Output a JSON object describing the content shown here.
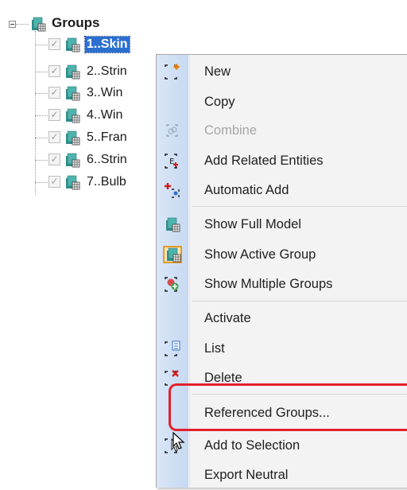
{
  "tree": {
    "root": {
      "label": "Groups",
      "icon": "group-folder-icon"
    },
    "items": [
      {
        "label": "1..Skin",
        "checked": true,
        "selected": true
      },
      {
        "label": "2..Strin",
        "checked": true,
        "selected": false
      },
      {
        "label": "3..Win",
        "checked": true,
        "selected": false
      },
      {
        "label": "4..Win",
        "checked": true,
        "selected": false
      },
      {
        "label": "5..Fran",
        "checked": true,
        "selected": false
      },
      {
        "label": "6..Strin",
        "checked": true,
        "selected": false
      },
      {
        "label": "7..Bulb",
        "checked": true,
        "selected": false
      }
    ]
  },
  "context_menu": {
    "items": [
      {
        "label": "New",
        "icon": "new-icon",
        "enabled": true
      },
      {
        "label": "Copy",
        "icon": "",
        "enabled": true
      },
      {
        "label": "Combine",
        "icon": "combine-icon",
        "enabled": false
      },
      {
        "label": "Add Related Entities",
        "icon": "add-related-icon",
        "enabled": true
      },
      {
        "label": "Automatic Add",
        "icon": "automatic-add-icon",
        "enabled": true
      },
      {
        "label": "Show Full Model",
        "icon": "full-model-icon",
        "enabled": true
      },
      {
        "label": "Show Active Group",
        "icon": "active-group-icon",
        "enabled": true
      },
      {
        "label": "Show Multiple Groups",
        "icon": "multiple-groups-icon",
        "enabled": true
      },
      {
        "label": "Activate",
        "icon": "",
        "enabled": true
      },
      {
        "label": "List",
        "icon": "list-icon",
        "enabled": true
      },
      {
        "label": "Delete",
        "icon": "delete-icon",
        "enabled": true
      },
      {
        "label": "Referenced Groups...",
        "icon": "",
        "enabled": true
      },
      {
        "label": "Add to Selection",
        "icon": "add-to-selection-icon",
        "enabled": true
      },
      {
        "label": "Export Neutral",
        "icon": "",
        "enabled": true
      }
    ]
  },
  "colors": {
    "selection": "#2b6fd1",
    "highlight_box": "#e3202c",
    "menu_gutter": "#d9e6f7"
  }
}
